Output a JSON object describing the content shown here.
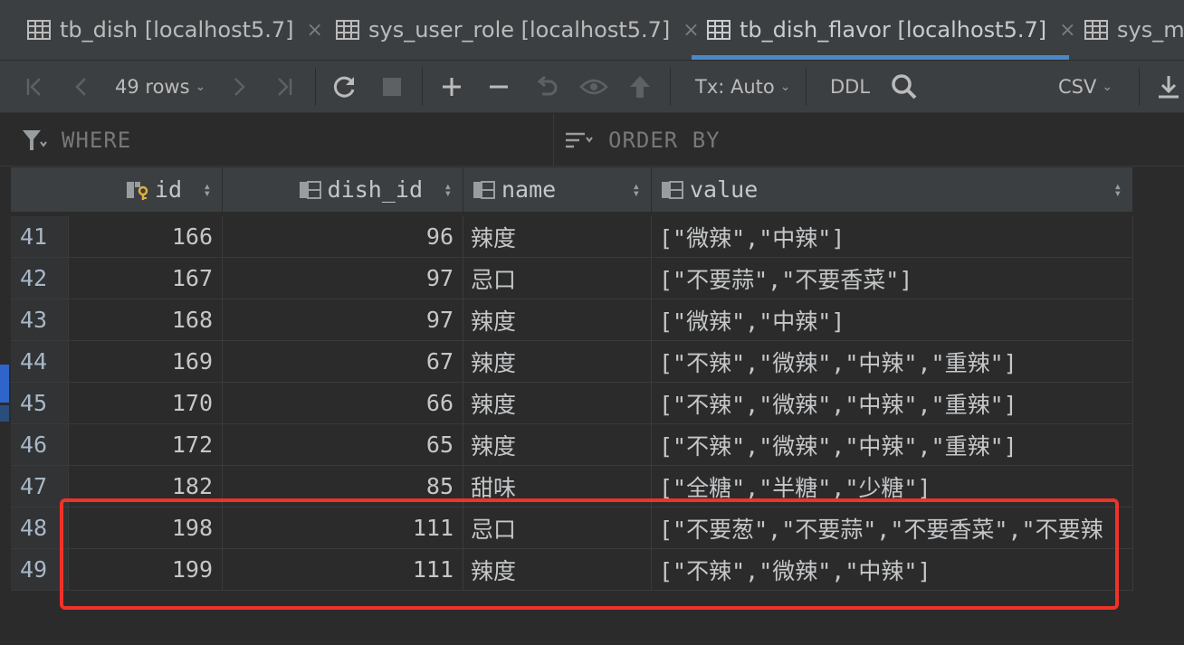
{
  "tabs": [
    {
      "label": "tb_dish [localhost5.7]",
      "close": "×"
    },
    {
      "label": "sys_user_role [localhost5.7]",
      "close": "×"
    },
    {
      "label": "tb_dish_flavor [localhost5.7]",
      "close": "×"
    },
    {
      "label": "sys_me",
      "close": ""
    }
  ],
  "toolbar": {
    "rows_label": "49 rows",
    "tx_label": "Tx: Auto",
    "ddl_label": "DDL",
    "export_label": "CSV"
  },
  "filter": {
    "where_label": "WHERE",
    "order_by_label": "ORDER BY"
  },
  "columns": [
    {
      "label": "id"
    },
    {
      "label": "dish_id"
    },
    {
      "label": "name"
    },
    {
      "label": "value"
    }
  ],
  "rows": [
    {
      "n": "41",
      "id": "166",
      "dish_id": "96",
      "name": "辣度",
      "value": "[\"微辣\",\"中辣\"]"
    },
    {
      "n": "42",
      "id": "167",
      "dish_id": "97",
      "name": "忌口",
      "value": "[\"不要蒜\",\"不要香菜\"]"
    },
    {
      "n": "43",
      "id": "168",
      "dish_id": "97",
      "name": "辣度",
      "value": "[\"微辣\",\"中辣\"]"
    },
    {
      "n": "44",
      "id": "169",
      "dish_id": "67",
      "name": "辣度",
      "value": "[\"不辣\",\"微辣\",\"中辣\",\"重辣\"]"
    },
    {
      "n": "45",
      "id": "170",
      "dish_id": "66",
      "name": "辣度",
      "value": "[\"不辣\",\"微辣\",\"中辣\",\"重辣\"]"
    },
    {
      "n": "46",
      "id": "172",
      "dish_id": "65",
      "name": "辣度",
      "value": "[\"不辣\",\"微辣\",\"中辣\",\"重辣\"]"
    },
    {
      "n": "47",
      "id": "182",
      "dish_id": "85",
      "name": "甜味",
      "value": "[\"全糖\",\"半糖\",\"少糖\"]"
    },
    {
      "n": "48",
      "id": "198",
      "dish_id": "111",
      "name": "忌口",
      "value": "[\"不要葱\",\"不要蒜\",\"不要香菜\",\"不要辣"
    },
    {
      "n": "49",
      "id": "199",
      "dish_id": "111",
      "name": "辣度",
      "value": "[\"不辣\",\"微辣\",\"中辣\"]"
    }
  ],
  "colors": {
    "active_tab_underline": "#4a88c7",
    "highlight_box": "#f0322a",
    "key_icon": "#e0b03c"
  }
}
